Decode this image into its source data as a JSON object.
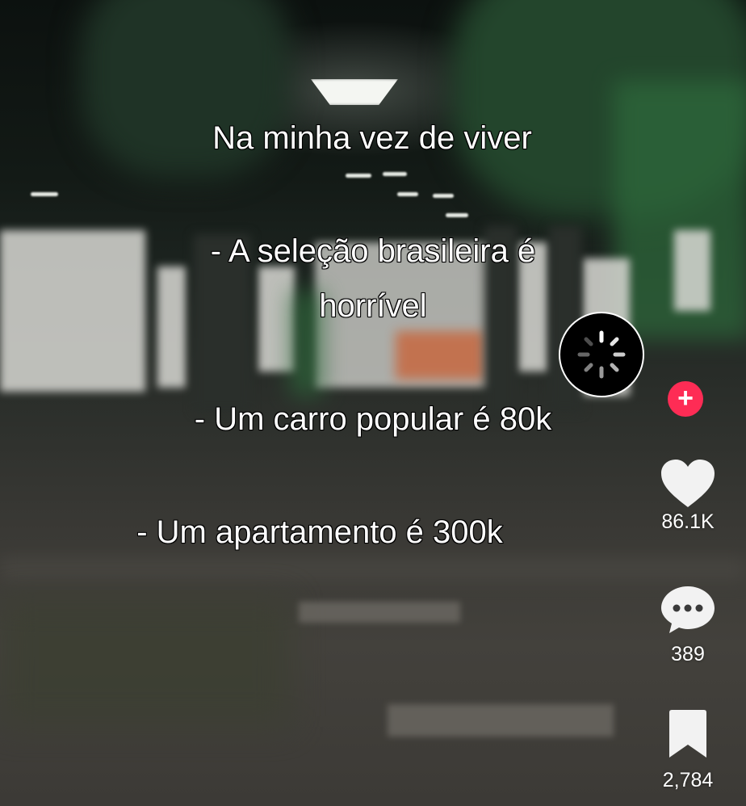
{
  "caption": {
    "line1": "Na minha vez de viver",
    "line2": "- A seleção brasileira é",
    "line3": "horrível",
    "line4": "- Um carro popular é 80k",
    "line5": "- Um apartamento é 300k"
  },
  "actions": {
    "likes": "86.1K",
    "comments": "389",
    "saves": "2,784",
    "follow_symbol": "+"
  },
  "icons": {
    "avatar": "loading-spinner-icon",
    "follow": "plus-icon",
    "like": "heart-icon",
    "comment": "comment-bubble-icon",
    "save": "bookmark-icon"
  },
  "colors": {
    "follow_accent": "#fe2c55",
    "icon": "#ffffff"
  }
}
